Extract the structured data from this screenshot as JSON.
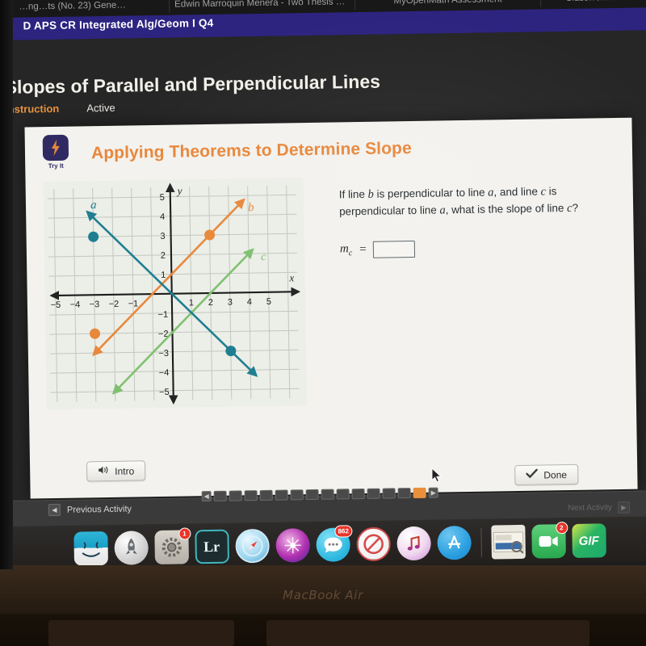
{
  "browser": {
    "tabs": [
      {
        "label": "…ng…ts (No. 23) Gene…"
      },
      {
        "label": "Edwin Marroquin Menera - Two Thesis St..."
      },
      {
        "label": "MyOpenMath Assessment"
      },
      {
        "label": "Classwork for Financ…"
      }
    ]
  },
  "site": {
    "header_title": "D APS CR Integrated Alg/Geom I Q4",
    "header_color": "#2d2480"
  },
  "lesson": {
    "title": "Slopes of Parallel and Perpendicular Lines",
    "tabs": [
      {
        "label": "Instruction",
        "state": "selected"
      },
      {
        "label": "Active",
        "state": "normal"
      }
    ]
  },
  "activity": {
    "badge_label": "Try It",
    "badge_icon": "lightning-bolt-icon",
    "heading": "Applying Theorems to Determine Slope",
    "heading_color": "#e8873c",
    "question_text": "If line b is perpendicular to line a, and line c is perpendicular to line a, what is the slope of line c?",
    "question_parts": {
      "p1": "If line ",
      "var_b": "b",
      "p2": " is perpendicular to line ",
      "var_a1": "a",
      "p3": ", and line ",
      "var_c": "c",
      "p4": " is perpendicular to line ",
      "var_a2": "a",
      "p5": ", what is the slope of line ",
      "var_c2": "c",
      "p6": "?"
    },
    "answer": {
      "label_m": "m",
      "label_sub": "c",
      "equals": "=",
      "value": "",
      "placeholder": ""
    },
    "buttons": {
      "intro": {
        "label": "Intro",
        "icon": "speaker-icon"
      },
      "done": {
        "label": "Done",
        "icon": "checkmark-icon"
      }
    }
  },
  "chart_data": {
    "type": "line",
    "title": "",
    "xlabel": "x",
    "ylabel": "y",
    "xlim": [
      -6,
      6
    ],
    "ylim": [
      -6,
      6
    ],
    "xticks": [
      -5,
      -4,
      -3,
      -2,
      -1,
      1,
      2,
      3,
      4,
      5
    ],
    "yticks": [
      5,
      4,
      3,
      2,
      1,
      -1,
      -2,
      -3,
      -4,
      -5
    ],
    "grid": true,
    "series": [
      {
        "name": "a",
        "label": "a",
        "color": "#1f7f91",
        "slope": -1,
        "intercept": 0,
        "x": [
          -4.3,
          4.3
        ],
        "y": [
          4.3,
          -4.3
        ],
        "points": [
          {
            "x": -3,
            "y": 3
          },
          {
            "x": 3,
            "y": -3
          }
        ],
        "arrows": "both",
        "label_pos": {
          "x": -3.45,
          "y": 4.3
        }
      },
      {
        "name": "b",
        "label": "b",
        "color": "#e8883a",
        "slope": 1,
        "intercept": 1,
        "x": [
          -4.1,
          3.8
        ],
        "y": [
          -3.1,
          4.8
        ],
        "points": [
          {
            "x": -3,
            "y": -2
          },
          {
            "x": 2,
            "y": 3
          }
        ],
        "arrows": "both",
        "label_pos": {
          "x": 4.1,
          "y": 4.45
        }
      },
      {
        "name": "c",
        "label": "c",
        "color": "#7fc06f",
        "slope": 1,
        "intercept": -2,
        "x": [
          -3.1,
          4.2
        ],
        "y": [
          -5.1,
          2.2
        ],
        "points": [],
        "arrows": "both",
        "label_pos": {
          "x": 4.6,
          "y": 1.75
        }
      }
    ]
  },
  "bottom_nav": {
    "previous_label": "Previous Activity",
    "previous_icon": "chevron-left-icon",
    "next_label": "Next Activity",
    "next_icon": "chevron-right-icon",
    "progress": {
      "total": 15,
      "current_index": 13,
      "left_arrow_icon": "chevron-left-icon",
      "right_arrow_icon": "chevron-right-icon"
    }
  },
  "dock": {
    "items": [
      {
        "name": "finder",
        "label": "Finder",
        "badge": null
      },
      {
        "name": "launchpad",
        "label": "Launchpad",
        "badge": null
      },
      {
        "name": "system-preferences",
        "label": "System Preferences",
        "badge": "1"
      },
      {
        "name": "lightroom",
        "label": "Lr",
        "badge": null
      },
      {
        "name": "safari",
        "label": "Safari",
        "badge": null
      },
      {
        "name": "siri",
        "label": "Siri",
        "badge": null
      },
      {
        "name": "messages",
        "label": "Messages",
        "badge": "862"
      },
      {
        "name": "blocked-app",
        "label": "Blocked",
        "badge": null
      },
      {
        "name": "itunes",
        "label": "iTunes",
        "badge": null
      },
      {
        "name": "app-store",
        "label": "App Store",
        "badge": null
      },
      {
        "name": "preview-document",
        "label": "Preview",
        "badge": null
      },
      {
        "name": "facetime",
        "label": "FaceTime",
        "badge": "2"
      },
      {
        "name": "gif-app",
        "label": "GIF",
        "badge": null
      }
    ]
  },
  "device": {
    "model_label": "MacBook Air"
  }
}
